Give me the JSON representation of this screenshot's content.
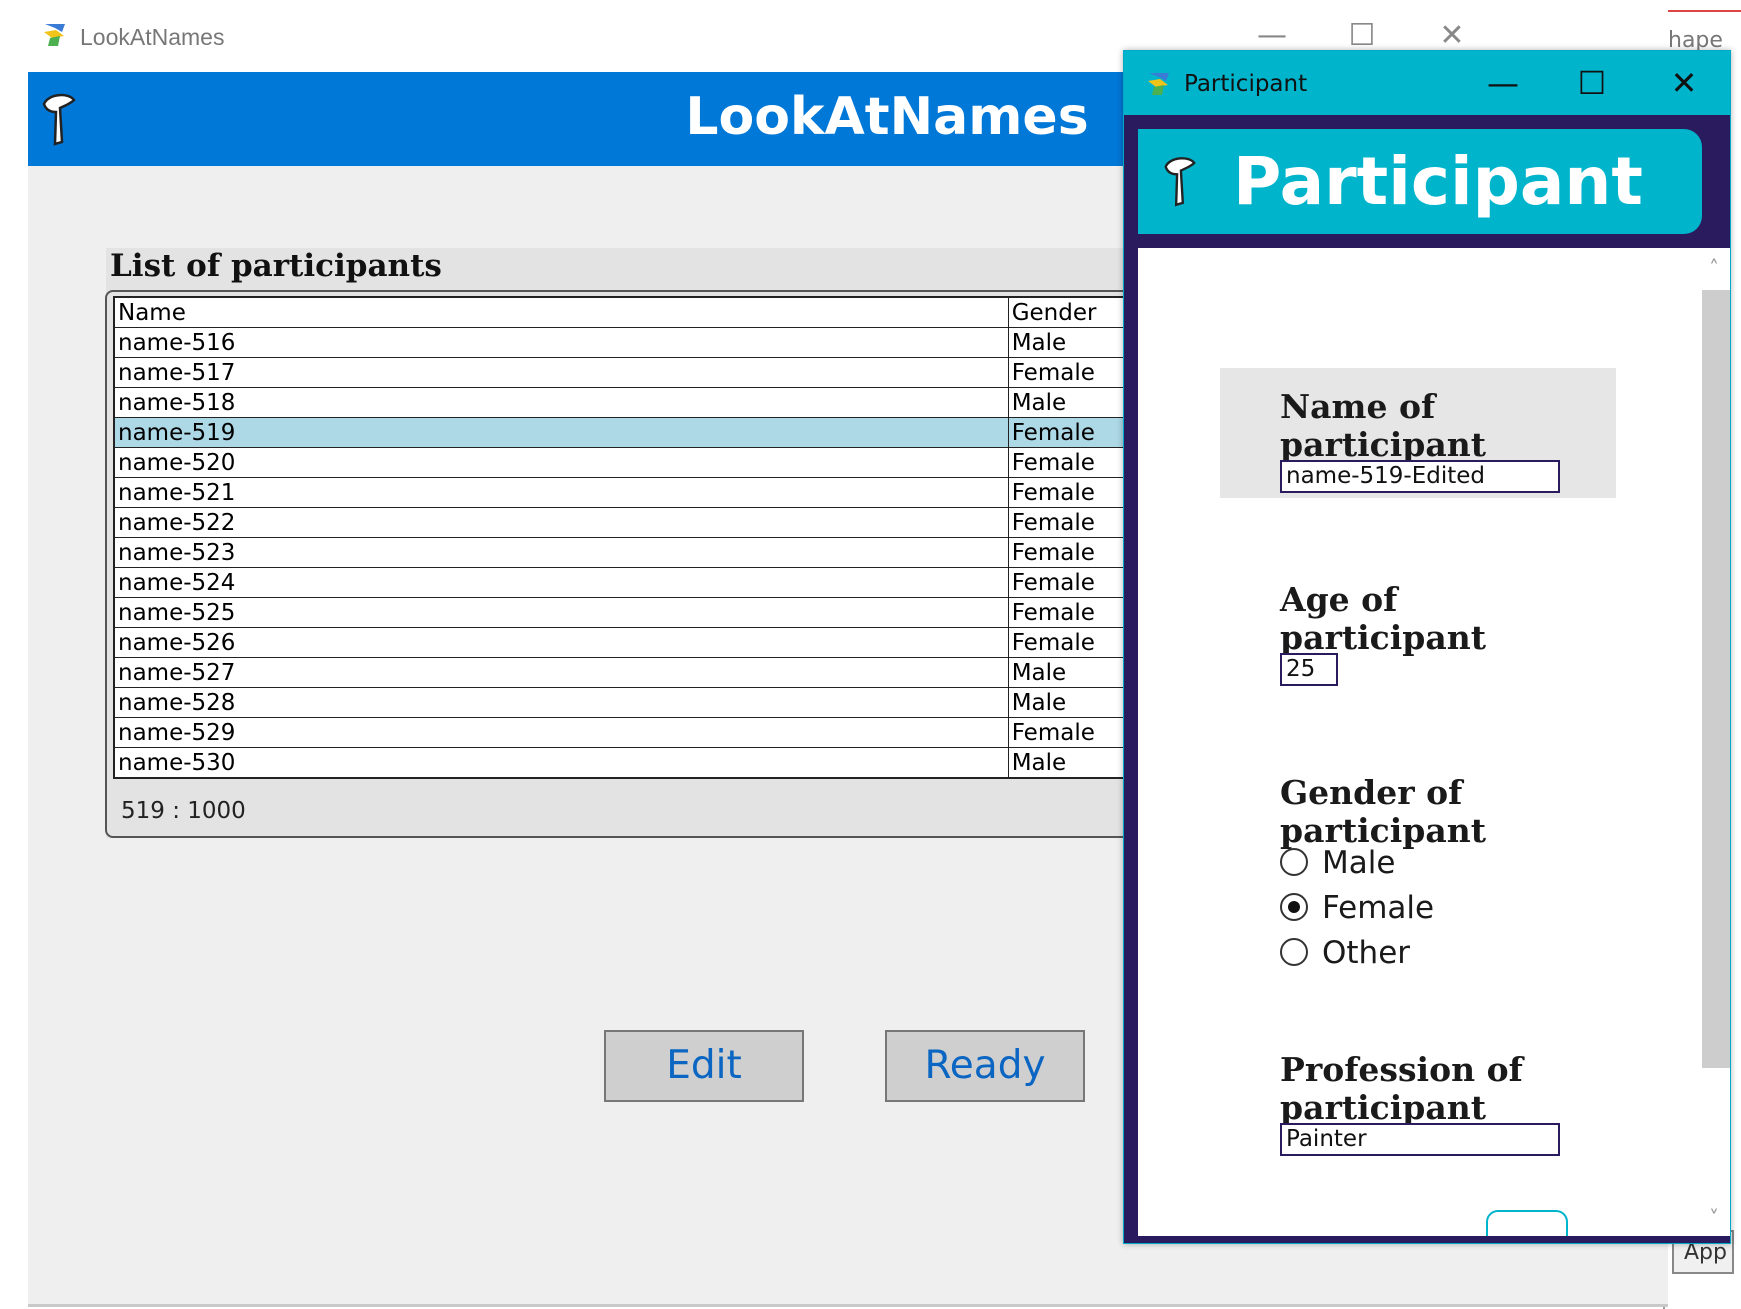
{
  "main_window": {
    "title": "LookAtNames",
    "header_title": "LookAtNames",
    "controls": {
      "minimize": "—",
      "maximize": "☐",
      "close": "✕"
    }
  },
  "list": {
    "title": "List of participants",
    "columns": [
      "Name",
      "Gender"
    ],
    "rows": [
      {
        "name": "name-516",
        "gender": "Male"
      },
      {
        "name": "name-517",
        "gender": "Female"
      },
      {
        "name": "name-518",
        "gender": "Male"
      },
      {
        "name": "name-519",
        "gender": "Female",
        "selected": true
      },
      {
        "name": "name-520",
        "gender": "Female"
      },
      {
        "name": "name-521",
        "gender": "Female"
      },
      {
        "name": "name-522",
        "gender": "Female"
      },
      {
        "name": "name-523",
        "gender": "Female"
      },
      {
        "name": "name-524",
        "gender": "Female"
      },
      {
        "name": "name-525",
        "gender": "Female"
      },
      {
        "name": "name-526",
        "gender": "Female"
      },
      {
        "name": "name-527",
        "gender": "Male"
      },
      {
        "name": "name-528",
        "gender": "Male"
      },
      {
        "name": "name-529",
        "gender": "Female"
      },
      {
        "name": "name-530",
        "gender": "Male"
      }
    ],
    "counter": "519 : 1000"
  },
  "buttons": {
    "edit": "Edit",
    "ready": "Ready"
  },
  "background_window": {
    "title_fragment": "hape F",
    "app_button": "App"
  },
  "dialog": {
    "title": "Participant",
    "banner_title": "Participant",
    "controls": {
      "minimize": "—",
      "maximize": "☐",
      "close": "✕"
    },
    "name_label": "Name of participant",
    "name_value": "name-519-Edited",
    "age_label": "Age of participant",
    "age_value": "25",
    "gender_label": "Gender of participant",
    "gender_options": [
      "Male",
      "Female",
      "Other"
    ],
    "gender_selected": "Female",
    "profession_label": "Profession of participant",
    "profession_value": "Painter"
  },
  "colors": {
    "header_blue": "#0078d7",
    "dialog_cyan": "#00b4cc",
    "dialog_frame": "#2a1a5e",
    "selected_row": "#add8e6",
    "button_text": "#0a66c2"
  },
  "icons": {
    "app": "app-icon",
    "logo": "logo-icon"
  }
}
